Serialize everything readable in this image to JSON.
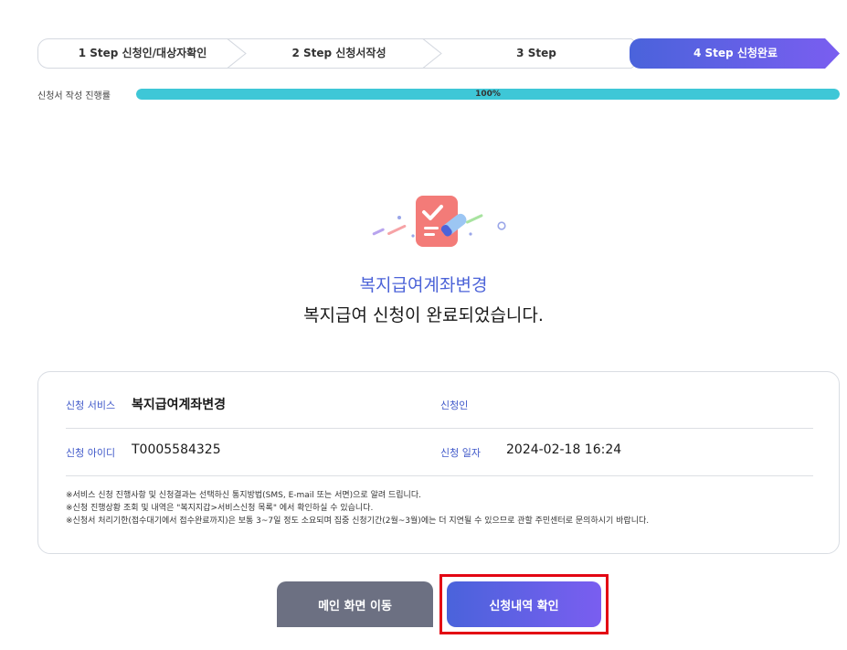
{
  "steps": [
    {
      "label": "1 Step 신청인/대상자확인",
      "active": false
    },
    {
      "label": "2 Step 신청서작성",
      "active": false
    },
    {
      "label": "3 Step",
      "active": false
    },
    {
      "label": "4 Step 신청완료",
      "active": true
    }
  ],
  "progress": {
    "caption": "신청서 작성 진행률",
    "value_percent": 100,
    "text": "100%"
  },
  "result": {
    "service_title": "복지급여계좌변경",
    "message": "복지급여 신청이 완료되었습니다."
  },
  "info": {
    "service_label": "신청 서비스",
    "service_value": "복지급여계좌변경",
    "applicant_label": "신청인",
    "applicant_value": "",
    "id_label": "신청 아이디",
    "id_value": "T0005584325",
    "date_label": "신청 일자",
    "date_value": "2024-02-18 16:24"
  },
  "notes": [
    "※서비스 신청 진행사항 및 신청결과는 선택하신 통지방법(SMS, E-mail 또는 서면)으로 알려 드립니다.",
    "※신청 진행상황 조회 및 내역은 \"복지지갑>서비스신청 목록\" 에서 확인하실 수 있습니다.",
    "※신청서 처리기한(접수대기에서 접수완료까지)은 보통 3~7일 정도 소요되며 집중 신청기간(2월~3월)에는 더 지연될 수 있으므로 관할 주민센터로 문의하시기 바랍니다."
  ],
  "buttons": {
    "main_label": "메인 화면 이동",
    "check_label": "신청내역 확인"
  },
  "colors": {
    "accent": "#4c63d8",
    "progress": "#3ec7d7",
    "highlight": "#e30613"
  }
}
